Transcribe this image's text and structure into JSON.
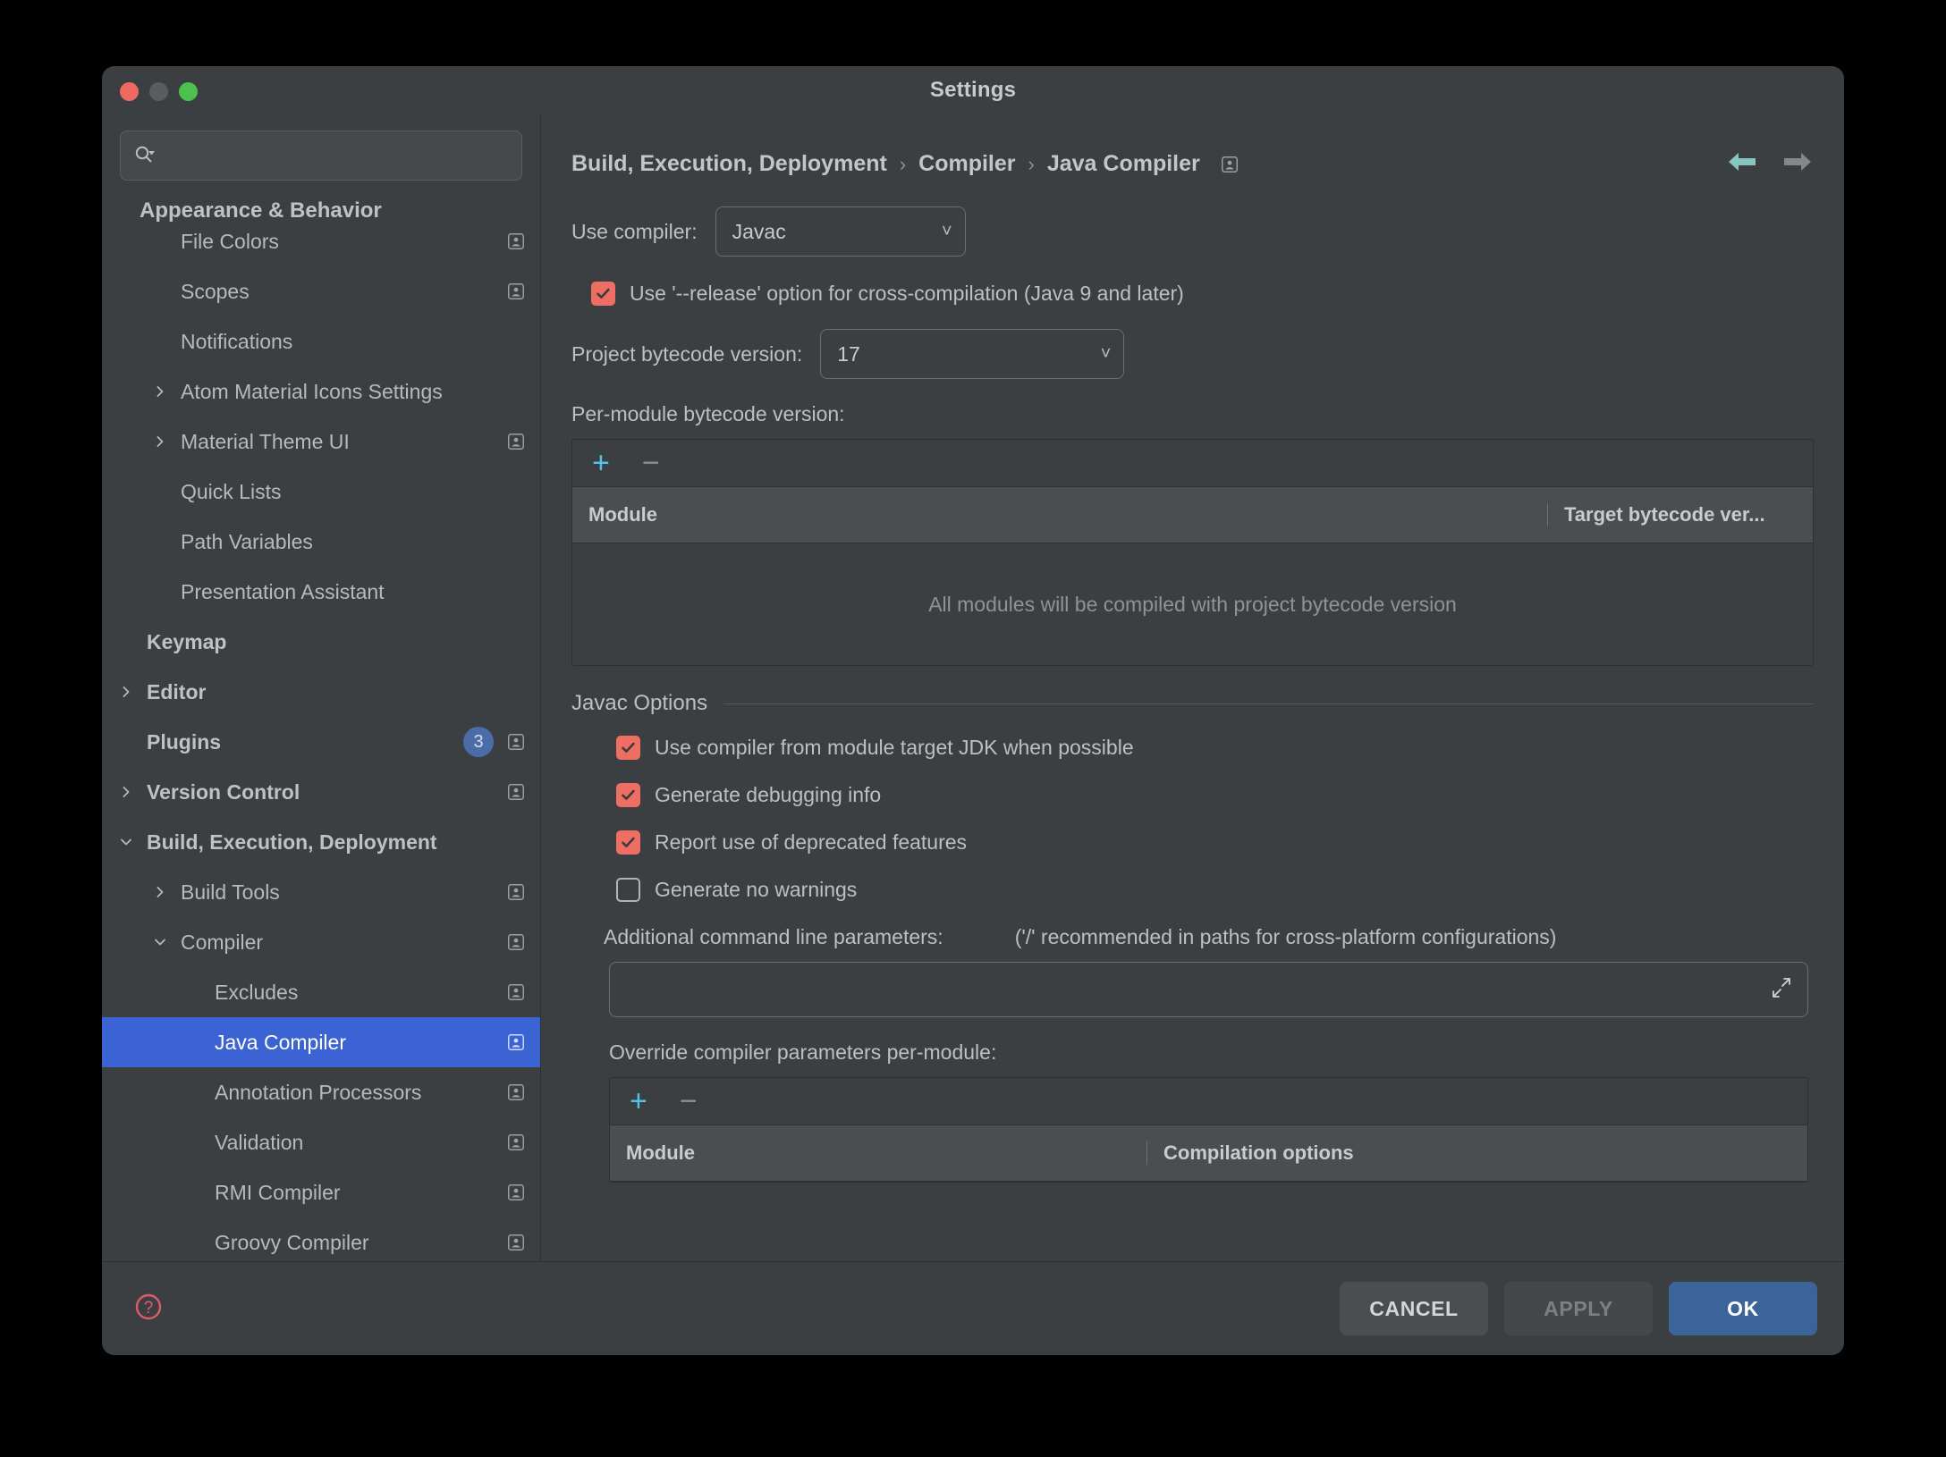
{
  "window": {
    "title": "Settings",
    "traffic_lights": [
      "close-button",
      "minimize-button",
      "maximize-button"
    ]
  },
  "sidebar": {
    "search": {
      "value": "",
      "placeholder": "",
      "icon": "search-icon"
    },
    "sticky_header": "Appearance & Behavior",
    "items": [
      {
        "label": "File Colors",
        "indent": 1,
        "chevron": "",
        "bold": false,
        "badge": true,
        "count": null,
        "selected": false,
        "clipped_top": true
      },
      {
        "label": "Scopes",
        "indent": 1,
        "chevron": "",
        "bold": false,
        "badge": true,
        "count": null,
        "selected": false
      },
      {
        "label": "Notifications",
        "indent": 1,
        "chevron": "",
        "bold": false,
        "badge": false,
        "count": null,
        "selected": false
      },
      {
        "label": "Atom Material Icons Settings",
        "indent": 1,
        "chevron": "right",
        "bold": false,
        "badge": false,
        "count": null,
        "selected": false
      },
      {
        "label": "Material Theme UI",
        "indent": 1,
        "chevron": "right",
        "bold": false,
        "badge": true,
        "count": null,
        "selected": false
      },
      {
        "label": "Quick Lists",
        "indent": 1,
        "chevron": "",
        "bold": false,
        "badge": false,
        "count": null,
        "selected": false
      },
      {
        "label": "Path Variables",
        "indent": 1,
        "chevron": "",
        "bold": false,
        "badge": false,
        "count": null,
        "selected": false
      },
      {
        "label": "Presentation Assistant",
        "indent": 1,
        "chevron": "",
        "bold": false,
        "badge": false,
        "count": null,
        "selected": false
      },
      {
        "label": "Keymap",
        "indent": 0,
        "chevron": "",
        "bold": true,
        "badge": false,
        "count": null,
        "selected": false
      },
      {
        "label": "Editor",
        "indent": 0,
        "chevron": "right",
        "bold": true,
        "badge": false,
        "count": null,
        "selected": false
      },
      {
        "label": "Plugins",
        "indent": 0,
        "chevron": "",
        "bold": true,
        "badge": true,
        "count": "3",
        "selected": false
      },
      {
        "label": "Version Control",
        "indent": 0,
        "chevron": "right",
        "bold": true,
        "badge": true,
        "count": null,
        "selected": false
      },
      {
        "label": "Build, Execution, Deployment",
        "indent": 0,
        "chevron": "down",
        "bold": true,
        "badge": false,
        "count": null,
        "selected": false
      },
      {
        "label": "Build Tools",
        "indent": 1,
        "chevron": "right",
        "bold": false,
        "badge": true,
        "count": null,
        "selected": false
      },
      {
        "label": "Compiler",
        "indent": 1,
        "chevron": "down",
        "bold": false,
        "badge": true,
        "count": null,
        "selected": false
      },
      {
        "label": "Excludes",
        "indent": 2,
        "chevron": "",
        "bold": false,
        "badge": true,
        "count": null,
        "selected": false
      },
      {
        "label": "Java Compiler",
        "indent": 2,
        "chevron": "",
        "bold": false,
        "badge": true,
        "count": null,
        "selected": true
      },
      {
        "label": "Annotation Processors",
        "indent": 2,
        "chevron": "",
        "bold": false,
        "badge": true,
        "count": null,
        "selected": false
      },
      {
        "label": "Validation",
        "indent": 2,
        "chevron": "",
        "bold": false,
        "badge": true,
        "count": null,
        "selected": false
      },
      {
        "label": "RMI Compiler",
        "indent": 2,
        "chevron": "",
        "bold": false,
        "badge": true,
        "count": null,
        "selected": false
      },
      {
        "label": "Groovy Compiler",
        "indent": 2,
        "chevron": "",
        "bold": false,
        "badge": true,
        "count": null,
        "selected": false
      }
    ]
  },
  "main": {
    "breadcrumb": [
      "Build, Execution, Deployment",
      "Compiler",
      "Java Compiler"
    ],
    "breadcrumb_separator": "›",
    "breadcrumb_badge": "project-setting-badge-icon",
    "nav": {
      "back": "back-arrow-icon",
      "forward": "forward-arrow-icon"
    },
    "use_compiler": {
      "label": "Use compiler:",
      "value": "Javac"
    },
    "release_option": {
      "label": "Use '--release' option for cross-compilation (Java 9 and later)",
      "checked": true
    },
    "project_bytecode": {
      "label": "Project bytecode version:",
      "value": "17"
    },
    "per_module": {
      "label": "Per-module bytecode version:",
      "toolbar": {
        "add": "+",
        "remove": "−"
      },
      "columns": [
        "Module",
        "Target bytecode ver..."
      ],
      "rows": [],
      "empty_text": "All modules will be compiled with project bytecode version"
    },
    "javac_options": {
      "title": "Javac Options",
      "checkboxes": [
        {
          "label": "Use compiler from module target JDK when possible",
          "checked": true
        },
        {
          "label": "Generate debugging info",
          "checked": true
        },
        {
          "label": "Report use of deprecated features",
          "checked": true
        },
        {
          "label": "Generate no warnings",
          "checked": false
        }
      ],
      "additional_params": {
        "label": "Additional command line parameters:",
        "hint": "('/' recommended in paths for cross-platform configurations)",
        "value": "",
        "placeholder": "",
        "expand_icon": "expand-icon"
      },
      "override_per_module": {
        "label": "Override compiler parameters per-module:",
        "toolbar": {
          "add": "+",
          "remove": "−"
        },
        "columns": [
          "Module",
          "Compilation options"
        ],
        "rows": []
      }
    }
  },
  "footer": {
    "help": "help-icon",
    "cancel_label": "CANCEL",
    "apply_label": "APPLY",
    "apply_enabled": false,
    "ok_label": "OK"
  },
  "colors": {
    "dialog_bg": "#3c3f41",
    "selection_blue": "#3b63d4",
    "checkbox_salmon": "#ee6e64",
    "accent_cyan": "#4fc3e8",
    "ok_blue": "#3b6498",
    "badge_blue": "#4a6ca8",
    "help_red": "#e05a6b"
  }
}
